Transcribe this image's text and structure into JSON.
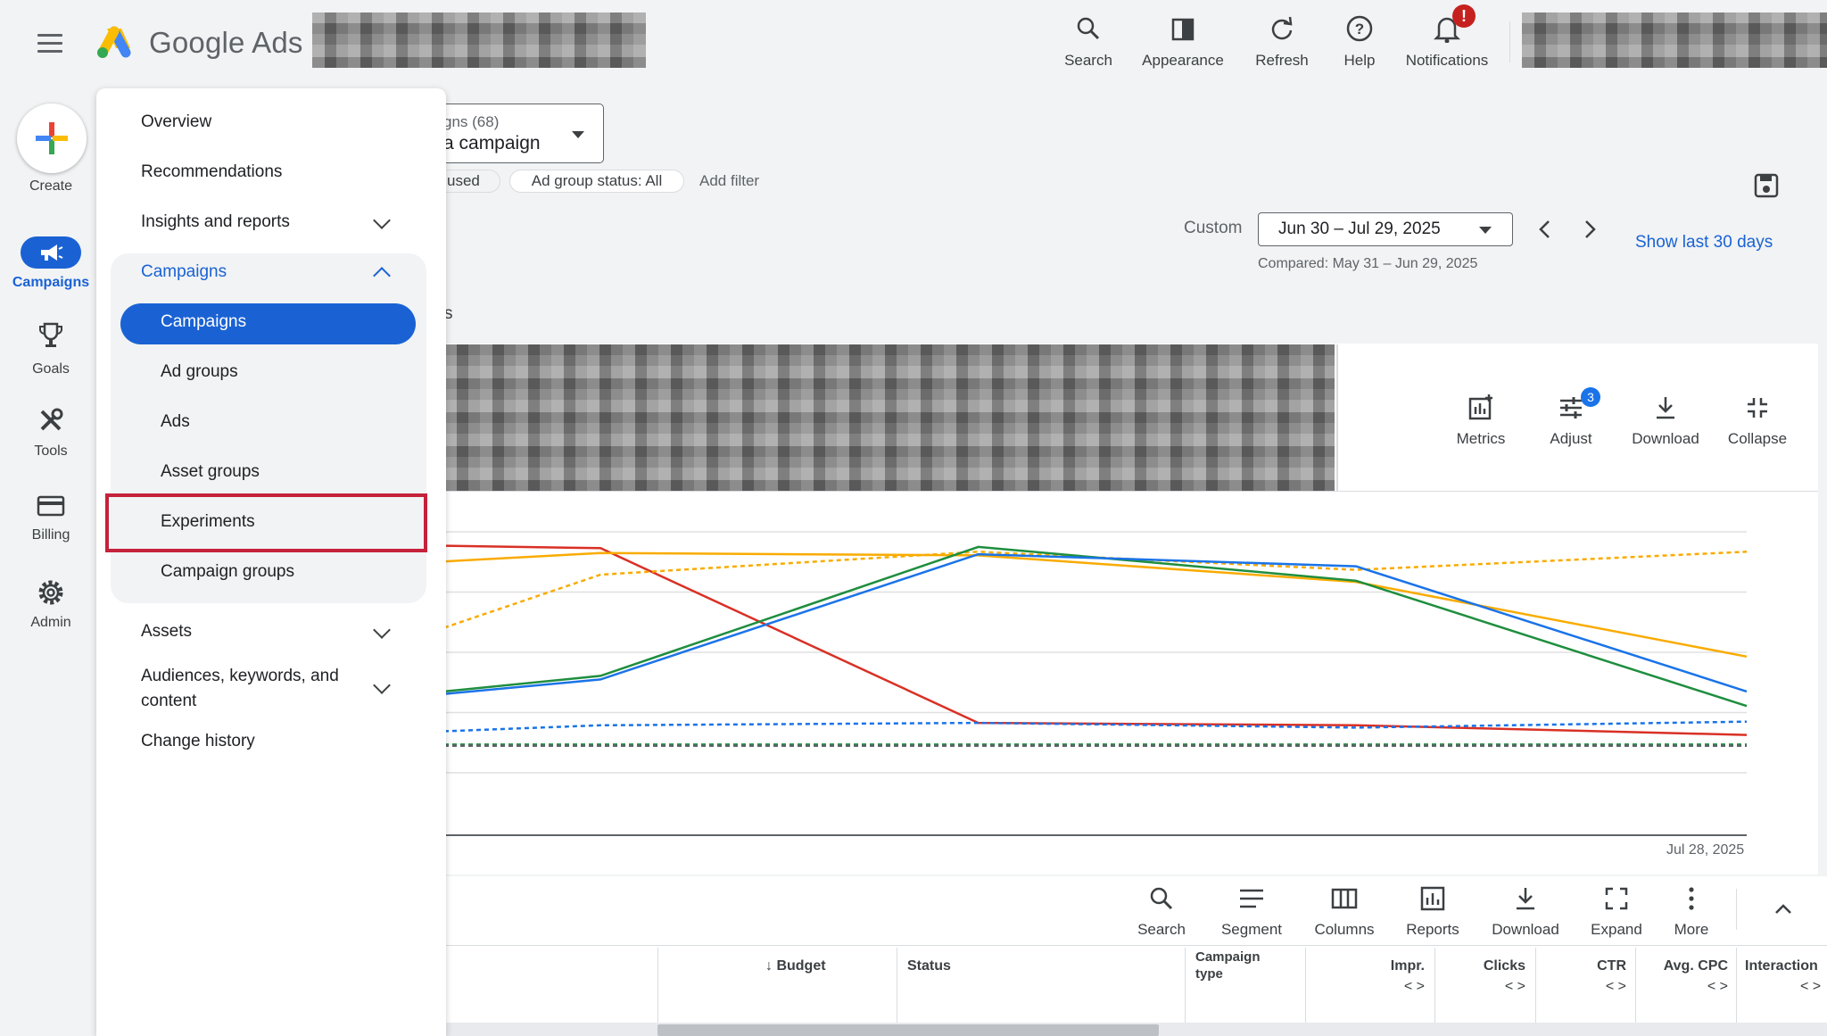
{
  "header": {
    "brand": "Google Ads",
    "tools": [
      {
        "label": "Search",
        "icon": "search-icon"
      },
      {
        "label": "Appearance",
        "icon": "appearance-icon"
      },
      {
        "label": "Refresh",
        "icon": "refresh-icon"
      },
      {
        "label": "Help",
        "icon": "help-icon"
      },
      {
        "label": "Notifications",
        "icon": "notifications-icon",
        "badge": "!"
      }
    ]
  },
  "left_rail": {
    "create": "Create",
    "campaigns": "Campaigns",
    "goals": "Goals",
    "tools": "Tools",
    "billing": "Billing",
    "admin": "Admin"
  },
  "nav_menu": {
    "overview": "Overview",
    "recommendations": "Recommendations",
    "insights": "Insights and reports",
    "campaigns_group": "Campaigns",
    "sub_items": [
      "Campaigns",
      "Ad groups",
      "Ads",
      "Asset groups",
      "Experiments",
      "Campaign groups"
    ],
    "assets": "Assets",
    "audiences_line1": "Audiences, keywords, and",
    "audiences_line2": "content",
    "change_history": "Change history"
  },
  "selector": {
    "line1": "gns (68)",
    "line2": "a campaign"
  },
  "filters": {
    "status_partial": "used",
    "ad_group_status": "Ad group status: All",
    "add_filter": "Add filter"
  },
  "date": {
    "label": "Custom",
    "range": "Jun 30 – Jul 29, 2025",
    "compared": "Compared: May 31 – Jun 29, 2025",
    "show_last": "Show last 30 days"
  },
  "tab_fragment": "s",
  "chart_tools": [
    {
      "label": "Metrics",
      "icon": "metrics-icon"
    },
    {
      "label": "Adjust",
      "icon": "adjust-icon",
      "badge": "3"
    },
    {
      "label": "Download",
      "icon": "download-icon"
    },
    {
      "label": "Collapse",
      "icon": "collapse-icon"
    }
  ],
  "chart_data": {
    "type": "line",
    "x_label_end": "Jul 28, 2025",
    "y_range": [
      0,
      100
    ],
    "series": [
      {
        "color": "#d93025",
        "style": "solid",
        "points": [
          [
            0,
            92
          ],
          [
            0.12,
            91
          ],
          [
            0.41,
            18.5
          ],
          [
            0.7,
            17.5
          ],
          [
            1,
            13.5
          ]
        ]
      },
      {
        "color": "#f9ab00",
        "style": "solid",
        "points": [
          [
            0,
            85.5
          ],
          [
            0.12,
            89
          ],
          [
            0.41,
            88
          ],
          [
            0.7,
            77
          ],
          [
            1,
            46
          ]
        ]
      },
      {
        "color": "#f9ab00",
        "style": "dashed",
        "points": [
          [
            0,
            58
          ],
          [
            0.12,
            80
          ],
          [
            0.41,
            89.5
          ],
          [
            0.7,
            82
          ],
          [
            1,
            89.5
          ]
        ]
      },
      {
        "color": "#1e8e3e",
        "style": "solid",
        "points": [
          [
            0,
            31.5
          ],
          [
            0.12,
            38
          ],
          [
            0.41,
            91.5
          ],
          [
            0.7,
            77.5
          ],
          [
            1,
            25.5
          ]
        ]
      },
      {
        "color": "#1a73e8",
        "style": "solid",
        "points": [
          [
            0,
            30.5
          ],
          [
            0.12,
            36.5
          ],
          [
            0.41,
            88.5
          ],
          [
            0.7,
            83.5
          ],
          [
            1,
            31.5
          ]
        ]
      },
      {
        "color": "#1a73e8",
        "style": "dashed",
        "points": [
          [
            0,
            15
          ],
          [
            0.12,
            17.5
          ],
          [
            0.41,
            18.5
          ],
          [
            0.7,
            16.5
          ],
          [
            1,
            19
          ]
        ]
      },
      {
        "color": "#1e8e3e",
        "style": "dashed",
        "points": [
          [
            0,
            9.5
          ],
          [
            1,
            9.5
          ]
        ]
      },
      {
        "color": "#5f6368",
        "style": "dashed",
        "points": [
          [
            0,
            9
          ],
          [
            1,
            9
          ]
        ]
      }
    ]
  },
  "table_tools": [
    {
      "label": "Search",
      "icon": "search-icon"
    },
    {
      "label": "Segment",
      "icon": "segment-icon"
    },
    {
      "label": "Columns",
      "icon": "columns-icon"
    },
    {
      "label": "Reports",
      "icon": "reports-icon"
    },
    {
      "label": "Download",
      "icon": "download-icon"
    },
    {
      "label": "Expand",
      "icon": "expand-icon"
    },
    {
      "label": "More",
      "icon": "more-icon"
    }
  ],
  "table_headers": {
    "budget": "Budget",
    "status": "Status",
    "type_line1": "Campaign",
    "type_line2": "type",
    "impr": "Impr.",
    "clicks": "Clicks",
    "ctr": "CTR",
    "avg_cpc": "Avg. CPC",
    "interaction": "Interaction",
    "sort_glyph": "< >"
  }
}
